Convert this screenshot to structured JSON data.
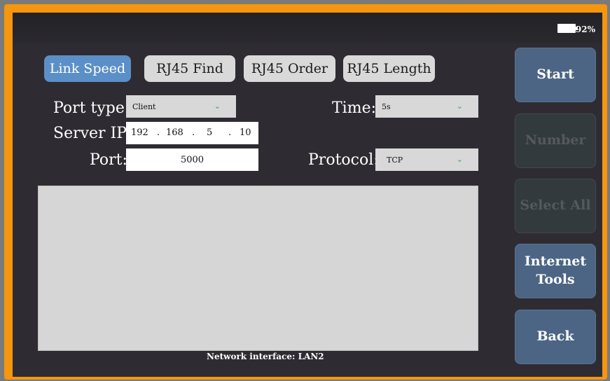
{
  "status": {
    "battery_percent": "92%"
  },
  "tabs": [
    {
      "label": "Link Speed",
      "active": true
    },
    {
      "label": "RJ45 Find",
      "active": false
    },
    {
      "label": "RJ45 Order",
      "active": false
    },
    {
      "label": "RJ45 Length",
      "active": false
    }
  ],
  "form": {
    "port_type": {
      "label": "Port type:",
      "value": "Client"
    },
    "time": {
      "label": "Time:",
      "value": "5s"
    },
    "server_ip": {
      "label": "Server IP:",
      "octets": [
        "192",
        "168",
        "5",
        "10"
      ]
    },
    "port": {
      "label": "Port:",
      "value": "5000"
    },
    "protocol": {
      "label": "Protocol:",
      "value": "TCP"
    }
  },
  "footer": {
    "network_interface": "Network interface: LAN2"
  },
  "side_buttons": [
    {
      "label": "Start",
      "enabled": true
    },
    {
      "label": "Number",
      "enabled": false
    },
    {
      "label": "Select All",
      "enabled": false
    },
    {
      "label": "Internet Tools",
      "enabled": true
    },
    {
      "label": "Back",
      "enabled": true
    }
  ],
  "colors": {
    "frame": "#f5960e",
    "screen_bg": "#2e2c32",
    "tab_active": "#5b8fc7",
    "side_button": "#4c6584",
    "side_button_disabled": "#333a3e"
  },
  "icons": {
    "battery": "battery-icon",
    "dropdown": "chevron-down-icon"
  }
}
